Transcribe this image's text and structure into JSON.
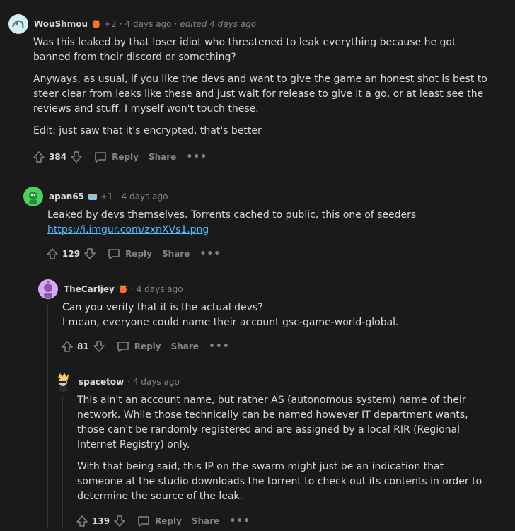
{
  "comments": [
    {
      "username": "WouShmou",
      "award_count": "+2",
      "time": "4 days ago",
      "edited": "edited 4 days ago",
      "paragraphs": [
        "Was this leaked by that loser idiot who threatened to leak everything because he got banned from their discord or something?",
        "Anyways, as usual, if you like the devs and want to give the game an honest shot is best to steer clear from leaks like these and just wait for release to give it a go, or at least see the reviews and stuff. I myself won't touch these.",
        "Edit: just saw that it's encrypted, that's better"
      ],
      "score": "384",
      "reply_label": "Reply",
      "share_label": "Share",
      "more_label": "•••"
    },
    {
      "username": "apan65",
      "award_count": "+1",
      "time": "4 days ago",
      "body_text": "Leaked by devs themselves. Torrents cached to public, this one of seeders ",
      "link_text": "https://i.imgur.com/zxnXVs1.png",
      "score": "129",
      "reply_label": "Reply",
      "share_label": "Share",
      "more_label": "•••"
    },
    {
      "username": "TheCarljey",
      "time": "4 days ago",
      "paragraphs": [
        "Can you verify that it is the actual devs?",
        "I mean, everyone could name their account gsc-game-world-global."
      ],
      "score": "81",
      "reply_label": "Reply",
      "share_label": "Share",
      "more_label": "•••"
    },
    {
      "username": "spacetow",
      "time": "4 days ago",
      "paragraphs": [
        "This ain't an account name, but rather AS (autonomous system) name of their network. While those technically can be named however IT department wants, those can't be randomly registered and are assigned by a local RIR (Regional Internet Registry) only.",
        "With that being said, this IP on the swarm might just be an indication that someone at the studio downloads the torrent to check out its contents in order to determine the source of the leak."
      ],
      "score": "139",
      "reply_label": "Reply",
      "share_label": "Share",
      "more_label": "•••"
    }
  ],
  "separator": "·",
  "colors": {
    "background": "#1a1a1b",
    "text": "#d7dadc",
    "muted": "#818384",
    "link": "#4fbcff",
    "thread_line": "#343536"
  },
  "icons": [
    "upvote-icon",
    "downvote-icon",
    "comment-bubble-icon"
  ]
}
